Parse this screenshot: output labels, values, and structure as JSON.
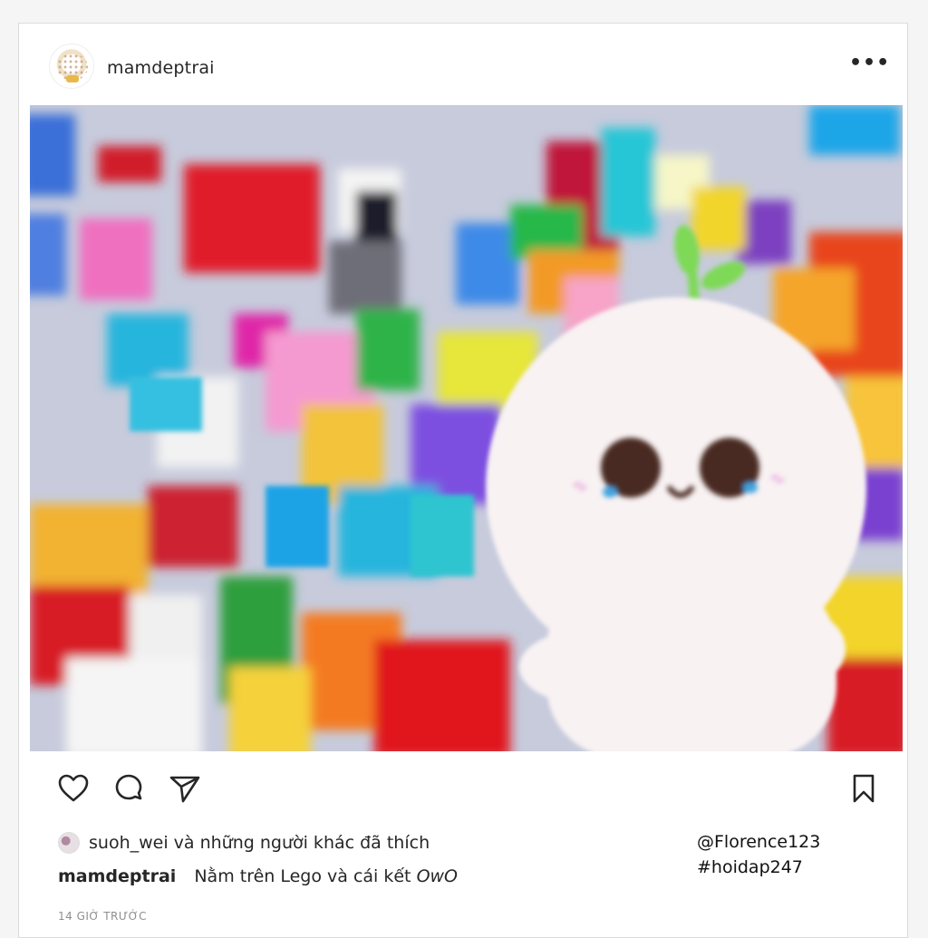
{
  "post": {
    "username": "mamdeptrai",
    "more_icon": "more-horizontal-icon",
    "image_alt": "cute white blob character on colorful Lego bricks",
    "actions": {
      "like_icon": "heart-icon",
      "comment_icon": "comment-icon",
      "share_icon": "send-icon",
      "save_icon": "bookmark-icon"
    },
    "likes_text": "suoh_wei và những người khác đã thích",
    "caption_user": "mamdeptrai",
    "caption_text": "Nằm trên Lego và cái kết",
    "caption_emote": "OwO",
    "time": "14 GIỜ TRƯỚC"
  },
  "overlay": {
    "mention": "@Florence123",
    "hashtag": "#hoidap247"
  },
  "colors": {
    "text": "#262626",
    "muted": "#8e8e8e",
    "border": "#dbdbdb",
    "sprout": "#7ed957"
  }
}
